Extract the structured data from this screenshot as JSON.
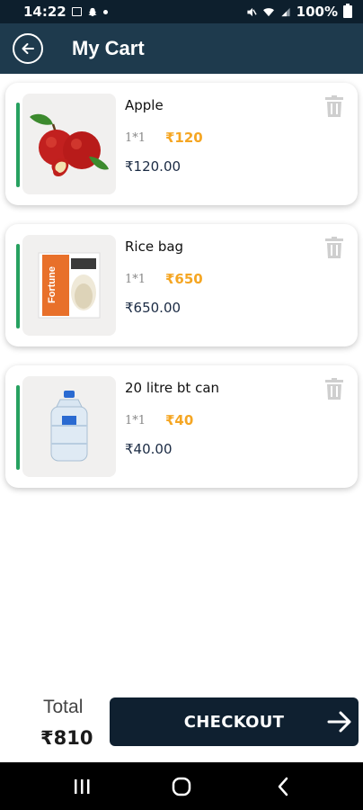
{
  "status_bar": {
    "time": "14:22",
    "battery": "100%"
  },
  "header": {
    "title": "My Cart"
  },
  "cart": {
    "items": [
      {
        "name": "Apple",
        "qty": "1*1",
        "unit_price": "₹120",
        "line_total": "₹120.00"
      },
      {
        "name": "Rice bag",
        "qty": "1*1",
        "unit_price": "₹650",
        "line_total": "₹650.00"
      },
      {
        "name": "20 litre bt can",
        "qty": "1*1",
        "unit_price": "₹40",
        "line_total": "₹40.00"
      }
    ]
  },
  "footer": {
    "total_label": "Total",
    "total_value": "₹810",
    "checkout_label": "CHECKOUT"
  },
  "colors": {
    "header_bg": "#1e3a4d",
    "accent_green": "#27a160",
    "price_orange": "#f5a623",
    "checkout_bg": "#0f2030"
  }
}
